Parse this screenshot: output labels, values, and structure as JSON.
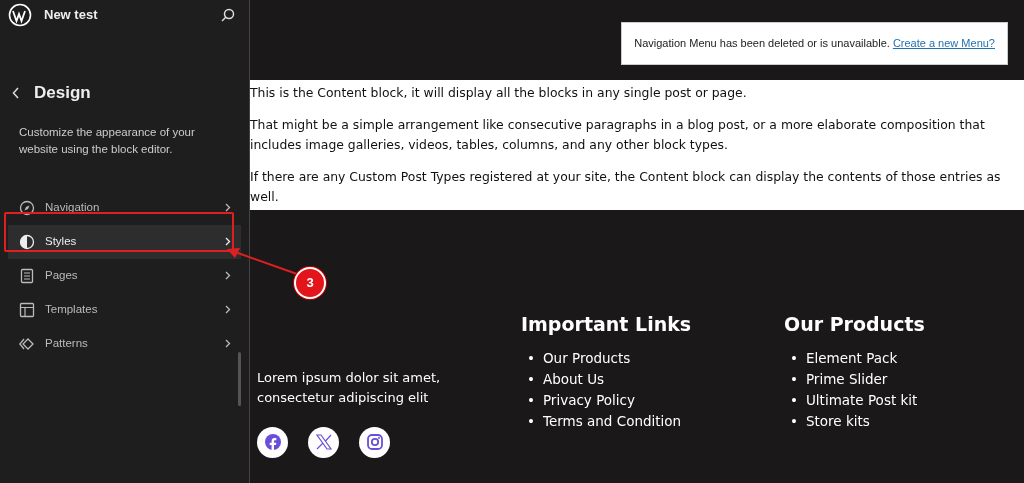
{
  "sidebar": {
    "site_title": "New test",
    "title": "Design",
    "description": "Customize the appearance of your website using the block editor.",
    "items": [
      {
        "label": "Navigation",
        "selected": false
      },
      {
        "label": "Styles",
        "selected": true
      },
      {
        "label": "Pages",
        "selected": false
      },
      {
        "label": "Templates",
        "selected": false
      },
      {
        "label": "Patterns",
        "selected": false
      }
    ]
  },
  "notice": {
    "text": "Navigation Menu has been deleted or is unavailable.",
    "link": "Create a new Menu?"
  },
  "content": [
    "This is the Content block, it will display all the blocks in any single post or page.",
    "That might be a simple arrangement like consecutive paragraphs in a blog post, or a more elaborate composition that includes image galleries, videos, tables, columns, and any other block types.",
    "If there are any Custom Post Types registered at your site, the Content block can display the contents of those entries as well."
  ],
  "footer": {
    "about": "Lorem ipsum dolor sit amet, consectetur adipiscing elit",
    "social": [
      {
        "kind": "facebook"
      },
      {
        "kind": "x"
      },
      {
        "kind": "instagram"
      }
    ],
    "columns": [
      {
        "heading": "Important Links",
        "marker": "•",
        "links": [
          "Our Products",
          "About Us",
          "Privacy Policy",
          "Terms and Condition"
        ]
      },
      {
        "heading": "Our Products",
        "marker": "•",
        "links": [
          "Element Pack",
          "Prime Slider",
          "Ultimate Post kit",
          "Store kits"
        ]
      }
    ]
  },
  "annotation": {
    "label": "3"
  }
}
